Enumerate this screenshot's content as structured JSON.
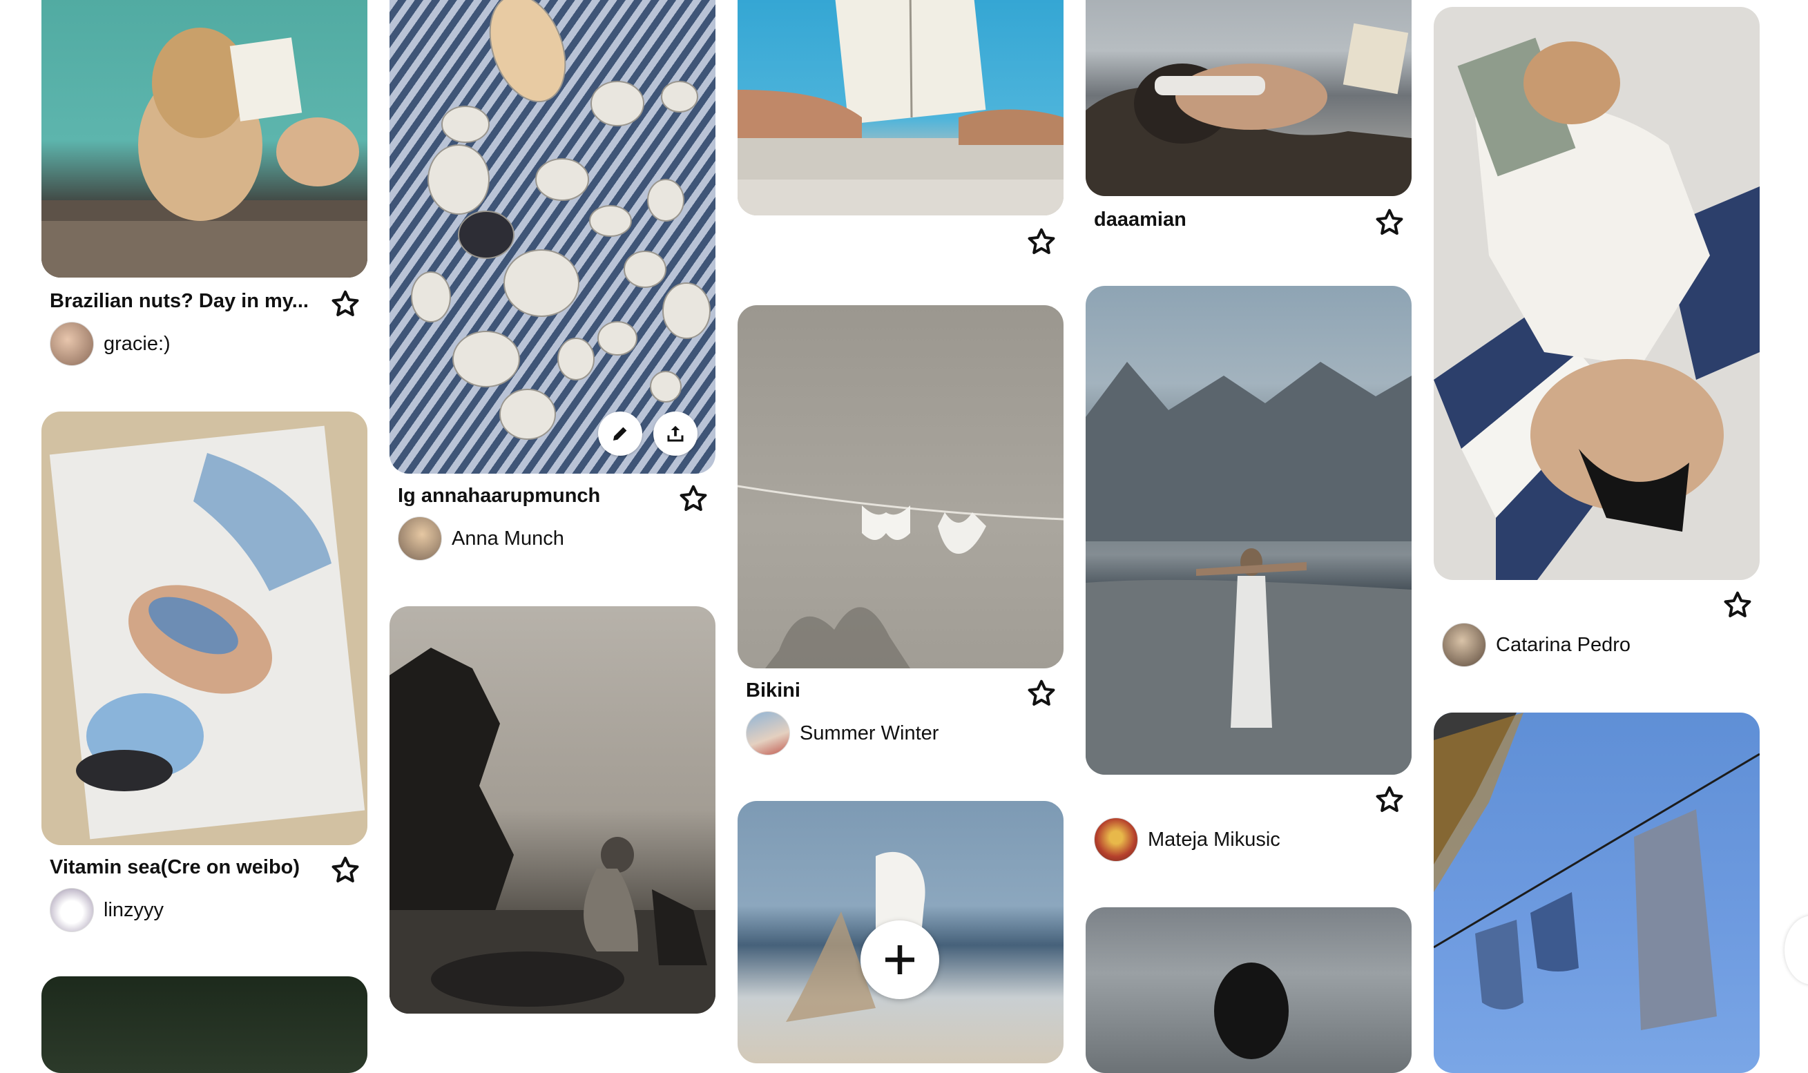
{
  "pins": [
    {
      "id": "pool-reading",
      "title": "Brazilian nuts? Day in my...",
      "creator": "gracie:)",
      "image": "woman reading book by pool"
    },
    {
      "id": "blanket-jeans",
      "title": "Vitamin sea(Cre on weibo)",
      "creator": "linzyyy",
      "image": "woman lying on blanket on sand"
    },
    {
      "id": "forest-dark",
      "title": "",
      "creator": "",
      "image": "dark forest"
    },
    {
      "id": "seashells",
      "title": "Ig annahaarupmunch",
      "creator": "Anna Munch",
      "image": "seashells on striped towel"
    },
    {
      "id": "bw-rock",
      "title": "",
      "creator": "",
      "image": "black and white woman on rock by sea"
    },
    {
      "id": "pool-book",
      "title": "",
      "creator": "",
      "image": "reading book at pool edge"
    },
    {
      "id": "bikini-line",
      "title": "Bikini",
      "creator": "Summer Winter",
      "image": "bikini on clothesline"
    },
    {
      "id": "beach-wind",
      "title": "",
      "creator": "",
      "image": "woman at beach with windblown hair"
    },
    {
      "id": "headphones",
      "title": "daaamian",
      "creator": "",
      "image": "woman with headphones on beach"
    },
    {
      "id": "mountain-beach",
      "title": "",
      "creator": "Mateja Mikusic",
      "image": "woman arms open on misty beach"
    },
    {
      "id": "sea-silhouette",
      "title": "",
      "creator": "",
      "image": "person in sea water"
    },
    {
      "id": "towel-book",
      "title": "",
      "creator": "Catarina Pedro",
      "image": "woman lying on striped towel with book"
    },
    {
      "id": "laundry-blue",
      "title": "",
      "creator": "",
      "image": "laundry on line against blue sky"
    }
  ],
  "actions": {
    "edit_icon": "pencil-icon",
    "share_icon": "share-icon",
    "save_icon": "star-icon",
    "create_icon": "plus-icon"
  },
  "colors": {
    "background": "#ffffff",
    "text": "#111111"
  }
}
